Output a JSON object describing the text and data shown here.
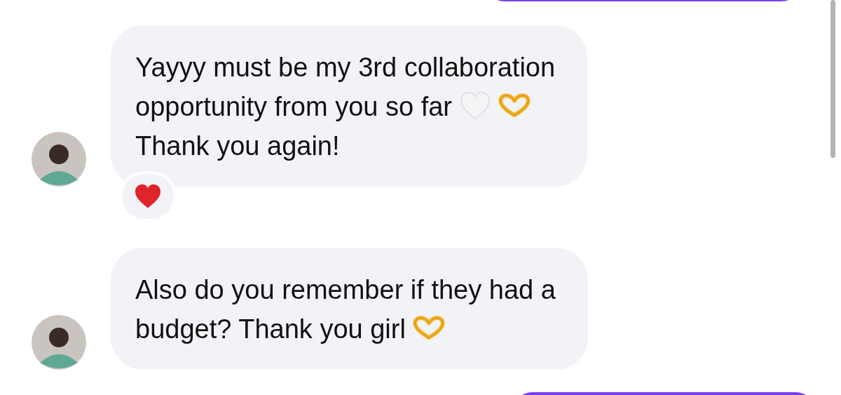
{
  "messages": [
    {
      "kind": "outgoing"
    },
    {
      "kind": "incoming",
      "parts": [
        {
          "kind": "line",
          "text": "Yayyy must be my 3rd collaboration"
        },
        {
          "kind": "text",
          "text": "opportunity from you so far"
        },
        {
          "kind": "white-heart"
        },
        {
          "kind": "heart-hands"
        },
        {
          "kind": "line",
          "text": "Thank you again!"
        }
      ],
      "reaction": {
        "kind": "red-heart"
      }
    },
    {
      "kind": "incoming",
      "parts": [
        {
          "kind": "line",
          "text": "Also do you remember if they had a"
        },
        {
          "kind": "text",
          "text": "budget? Thank you girl"
        },
        {
          "kind": "heart-hands"
        }
      ]
    },
    {
      "kind": "outgoing"
    }
  ]
}
